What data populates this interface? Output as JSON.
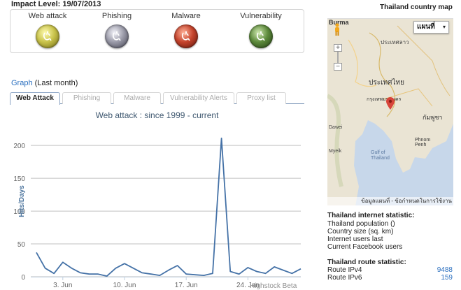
{
  "impact": {
    "title": "Impact Level: 19/07/2013",
    "levels": [
      {
        "label": "Web attack",
        "color": "#c8c24a"
      },
      {
        "label": "Phishing",
        "color": "#9a9aa8"
      },
      {
        "label": "Malware",
        "color": "#c4432c"
      },
      {
        "label": "Vulnerability",
        "color": "#5d8a3c"
      }
    ]
  },
  "graph": {
    "heading_link": "Graph",
    "heading_rest": " (Last month)",
    "tabs": [
      "Web Attack",
      "Phishing",
      "Malware",
      "Vulnerability Alerts",
      "Proxy list"
    ],
    "credit": "Highstock Beta"
  },
  "chart_data": {
    "type": "line",
    "title": "Web attack : since 1999 - current",
    "xlabel": "",
    "ylabel": "Hits/Days",
    "ylim": [
      0,
      230
    ],
    "yticks": [
      0,
      50,
      100,
      150,
      200
    ],
    "xticks": [
      "3. Jun",
      "10. Jun",
      "17. Jun",
      "24. Jun"
    ],
    "x": [
      "May 31",
      "Jun 1",
      "Jun 2",
      "Jun 3",
      "Jun 4",
      "Jun 5",
      "Jun 6",
      "Jun 7",
      "Jun 8",
      "Jun 9",
      "Jun 10",
      "Jun 11",
      "Jun 12",
      "Jun 13",
      "Jun 14",
      "Jun 15",
      "Jun 16",
      "Jun 17",
      "Jun 18",
      "Jun 19",
      "Jun 20",
      "Jun 21",
      "Jun 22",
      "Jun 23",
      "Jun 24",
      "Jun 25",
      "Jun 26",
      "Jun 27",
      "Jun 28",
      "Jun 29",
      "Jun 30"
    ],
    "series": [
      {
        "values": [
          37,
          13,
          5,
          22,
          13,
          6,
          4,
          4,
          1,
          13,
          20,
          13,
          6,
          4,
          2,
          10,
          17,
          4,
          3,
          2,
          5,
          211,
          8,
          4,
          14,
          8,
          5,
          15,
          10,
          5,
          12
        ]
      }
    ],
    "color": "#4572a7"
  },
  "map": {
    "title": "Thailand country map",
    "type_label": "แผนที่",
    "labels": [
      "Burma",
      "ประเทศไทย",
      "ประเทศลาว",
      "กรุงเทพมหานคร",
      "กัมพูชา",
      "Gulf of Thailand",
      "Phnom Penh",
      "Dawei",
      "Myeik"
    ],
    "attribution": "ข้อมูลแผนที่ - ข้อกำหนดในการใช้งาน",
    "zoom_in": "+",
    "zoom_out": "−"
  },
  "stats": {
    "internet_title": "Thailand internet statistic:",
    "internet_lines": [
      "Thailand population ()",
      "Country size (sq. km)",
      "Internet users last",
      "Current Facebook users"
    ],
    "route_title": "Thailand route statistic:",
    "routes": [
      {
        "label": "Route IPv4",
        "value": "9488"
      },
      {
        "label": "Route IPv6",
        "value": "159"
      }
    ]
  }
}
